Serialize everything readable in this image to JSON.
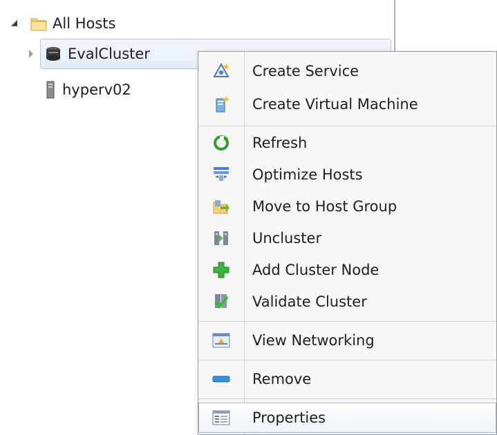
{
  "tree": {
    "root": {
      "label": "All Hosts",
      "expander": "expanded-arrow",
      "icon": "folder-icon"
    },
    "children": [
      {
        "label": "EvalCluster",
        "expander": "collapsed-arrow",
        "icon": "cluster-icon",
        "selected": true
      },
      {
        "label": "hyperv02",
        "icon": "server-icon"
      }
    ]
  },
  "context_menu": {
    "groups": [
      [
        {
          "label": "Create Service",
          "icon": "create-service-icon"
        },
        {
          "label": "Create Virtual Machine",
          "icon": "create-vm-icon"
        }
      ],
      [
        {
          "label": "Refresh",
          "icon": "refresh-icon"
        },
        {
          "label": "Optimize Hosts",
          "icon": "optimize-hosts-icon"
        },
        {
          "label": "Move to Host Group",
          "icon": "move-folder-icon"
        },
        {
          "label": "Uncluster",
          "icon": "uncluster-icon"
        },
        {
          "label": "Add Cluster Node",
          "icon": "add-plus-icon"
        },
        {
          "label": "Validate Cluster",
          "icon": "validate-check-icon"
        }
      ],
      [
        {
          "label": "View Networking",
          "icon": "networking-icon"
        }
      ],
      [
        {
          "label": "Remove",
          "icon": "remove-minus-icon"
        }
      ],
      [
        {
          "label": "Properties",
          "icon": "properties-icon",
          "hovered": true
        }
      ]
    ]
  },
  "colors": {
    "selection_border": "#b6c6d9",
    "hover_border": "#9fb8d6",
    "menu_background": "#f7f7f7",
    "refresh_green": "#2e9c2e",
    "add_green": "#3cb43c",
    "remove_blue": "#3b8fd8"
  }
}
